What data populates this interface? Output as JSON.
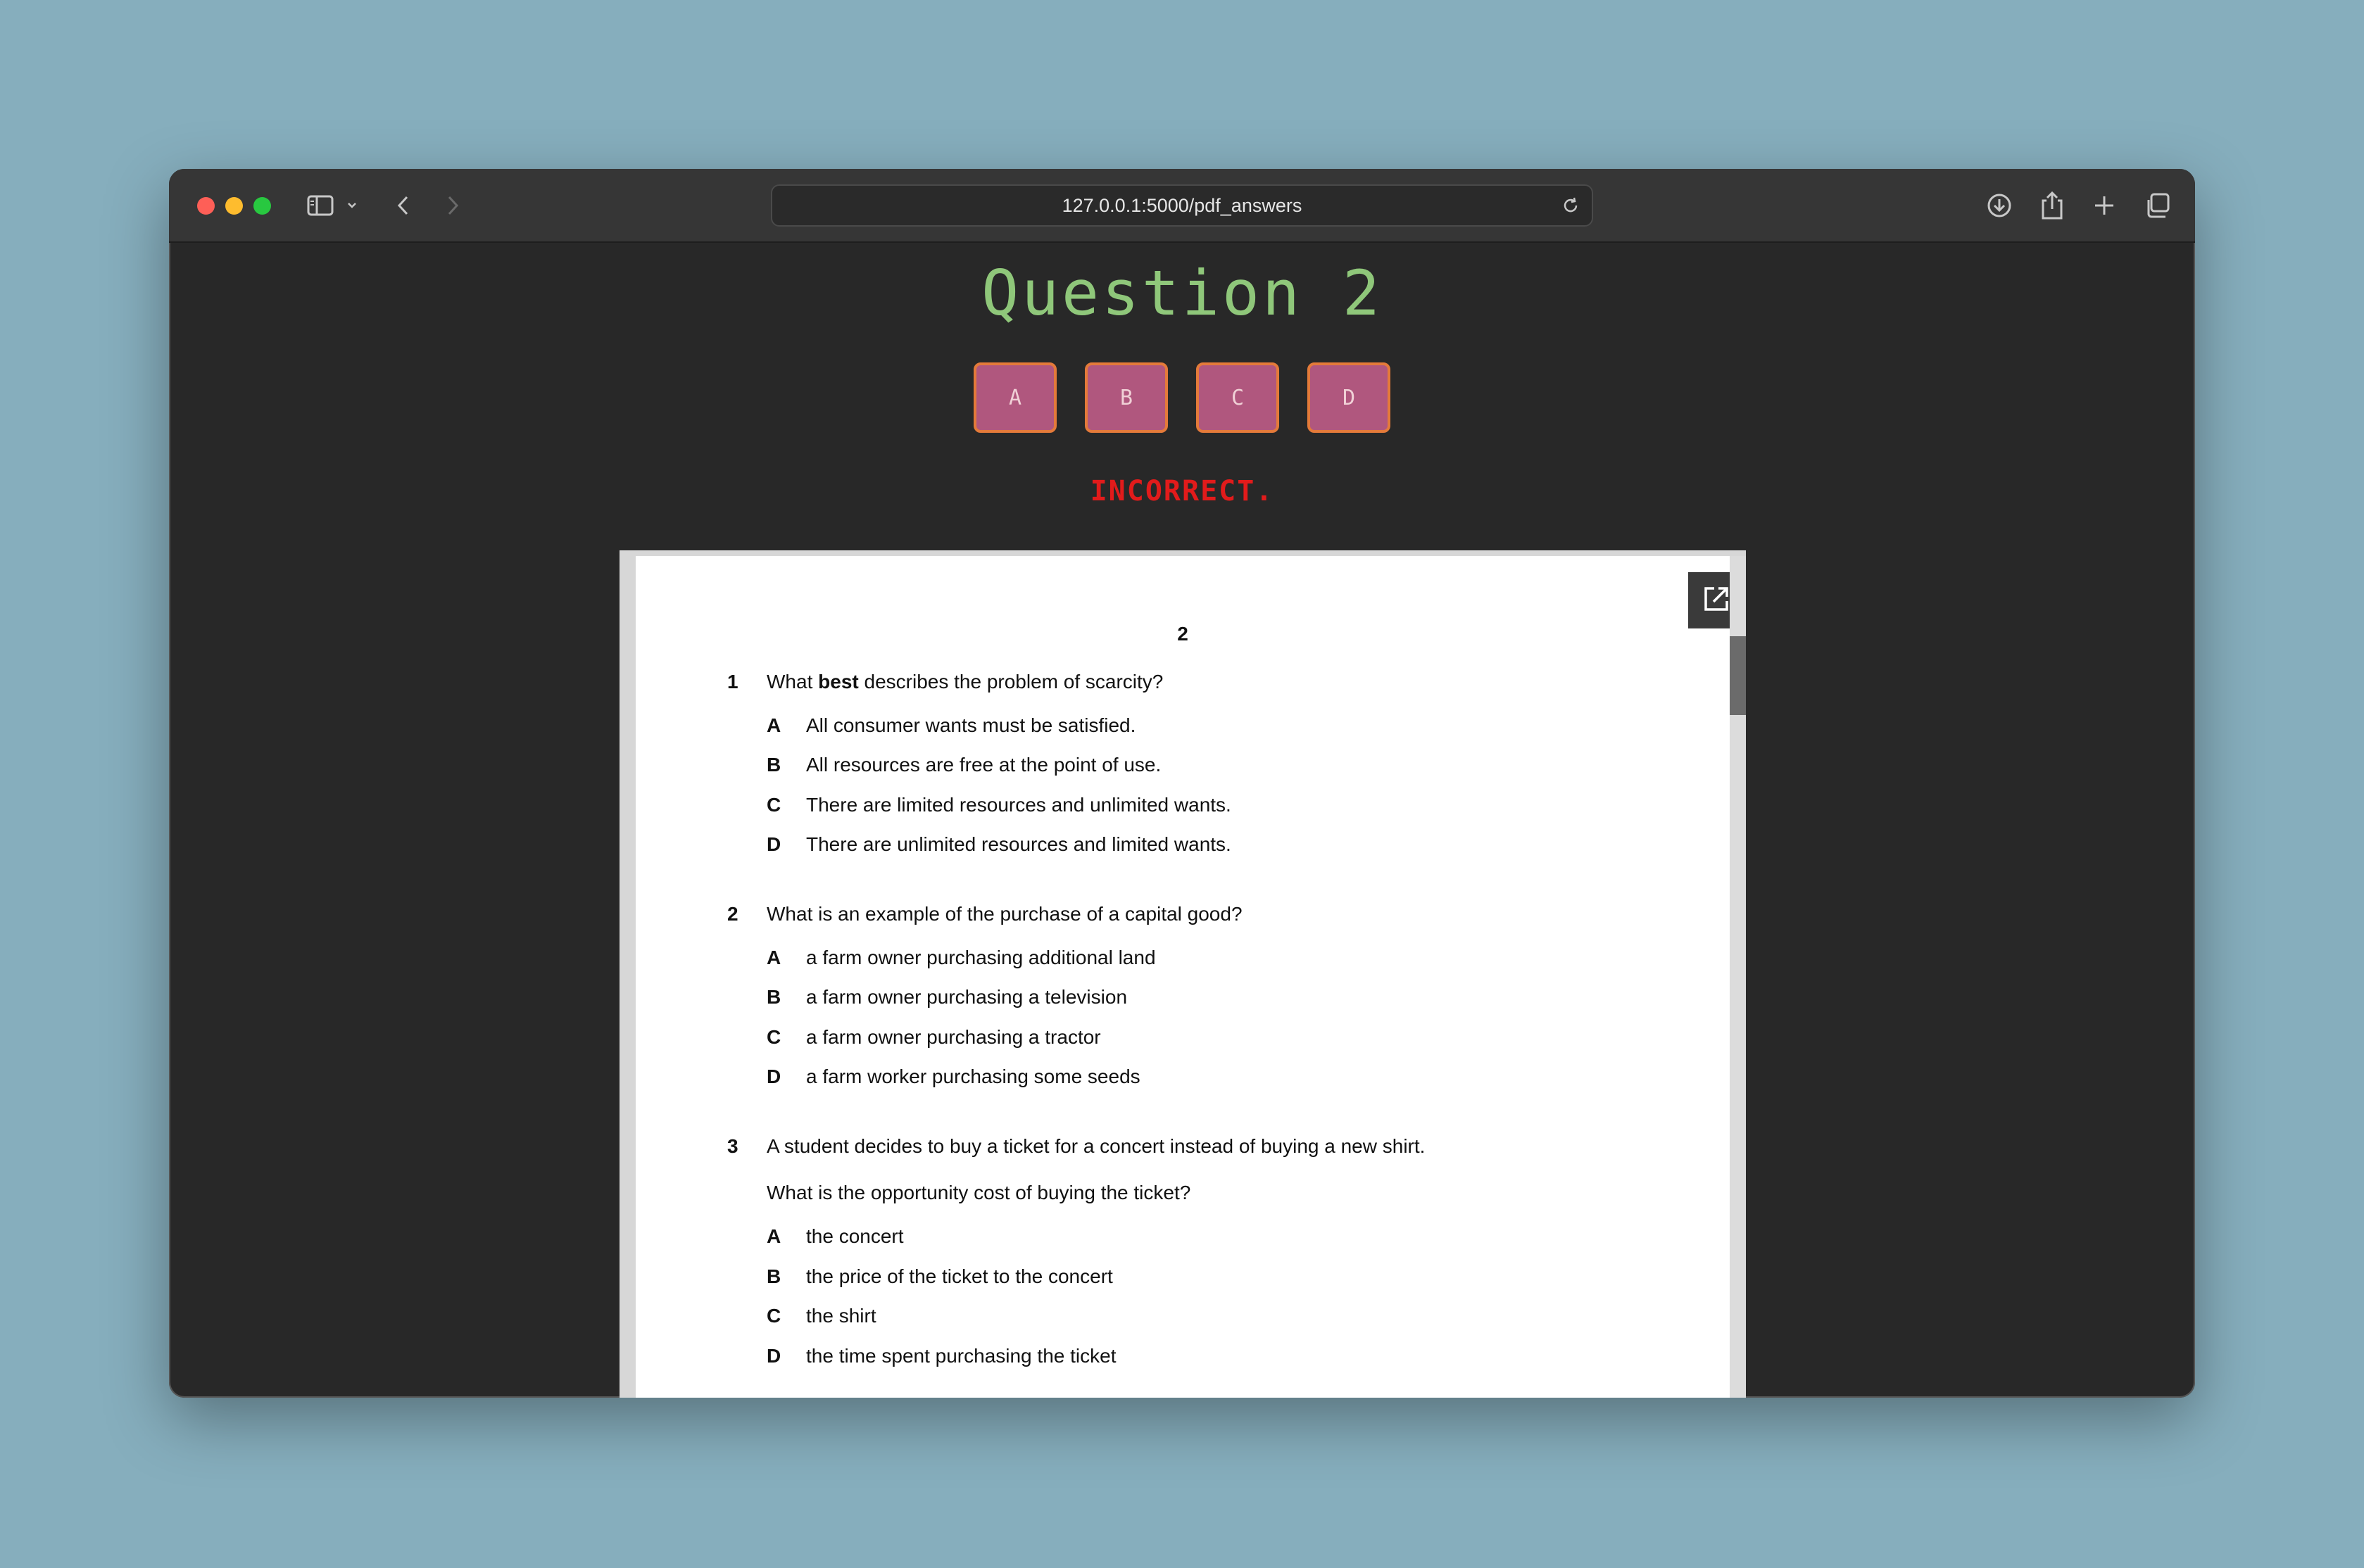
{
  "browser": {
    "url": "127.0.0.1:5000/pdf_answers"
  },
  "quiz": {
    "title": "Question 2",
    "answers": [
      "A",
      "B",
      "C",
      "D"
    ],
    "result": "INCORRECT."
  },
  "pdf": {
    "page_number": "2",
    "questions": [
      {
        "number": "1",
        "text_before": "What ",
        "text_bold": "best",
        "text_after": " describes the problem of scarcity?",
        "options": [
          {
            "letter": "A",
            "text": "All consumer wants must be satisfied."
          },
          {
            "letter": "B",
            "text": "All resources are free at the point of use."
          },
          {
            "letter": "C",
            "text": "There are limited resources and unlimited wants."
          },
          {
            "letter": "D",
            "text": "There are unlimited resources and limited wants."
          }
        ]
      },
      {
        "number": "2",
        "text": "What is an example of the purchase of a capital good?",
        "options": [
          {
            "letter": "A",
            "text": "a farm owner purchasing additional land"
          },
          {
            "letter": "B",
            "text": "a farm owner purchasing a television"
          },
          {
            "letter": "C",
            "text": "a farm owner purchasing a tractor"
          },
          {
            "letter": "D",
            "text": "a farm worker purchasing some seeds"
          }
        ]
      },
      {
        "number": "3",
        "text": "A student decides to buy a ticket for a concert instead of buying a new shirt.",
        "subtext": "What is the opportunity cost of buying the ticket?",
        "options": [
          {
            "letter": "A",
            "text": "the concert"
          },
          {
            "letter": "B",
            "text": "the price of the ticket to the concert"
          },
          {
            "letter": "C",
            "text": "the shirt"
          },
          {
            "letter": "D",
            "text": "the time spent purchasing the ticket"
          }
        ]
      }
    ]
  }
}
